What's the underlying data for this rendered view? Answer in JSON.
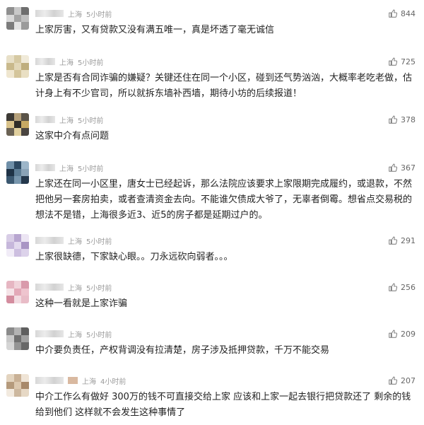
{
  "comments": [
    {
      "location": "上海",
      "time": "5小时前",
      "likes": "844",
      "text": "上家厉害，又有贷款又没有满五唯一，真是坏透了毫无诚信"
    },
    {
      "location": "上海",
      "time": "5小时前",
      "likes": "725",
      "text": "上家是否有合同诈骗的嫌疑？关键还住在同一个小区，碰到还气势汹汹，大概率老吃老做，估计身上有不少官司，所以就拆东墙补西墙，期待小坊的后续报道！"
    },
    {
      "location": "上海",
      "time": "5小时前",
      "likes": "378",
      "text": "这家中介有点问题"
    },
    {
      "location": "上海",
      "time": "5小时前",
      "likes": "367",
      "text": "上家还在同一小区里，唐女士已经起诉，那么法院应该要求上家限期完成履约，或退款，不然把他另一套房拍卖，或者查清资金去向。不能谁欠债成大爷了，无辜者倒霉。想省点交易税的想法不是错，上海很多近3、近5的房子都是延期过户的。"
    },
    {
      "location": "上海",
      "time": "5小时前",
      "likes": "291",
      "text": "上家很缺德，下家缺心眼。。刀永远砍向弱者。。。"
    },
    {
      "location": "上海",
      "time": "5小时前",
      "likes": "256",
      "text": "这种一看就是上家诈骗"
    },
    {
      "location": "上海",
      "time": "5小时前",
      "likes": "209",
      "text": "中介要负责任，产权背调没有拉清楚，房子涉及抵押贷款，千万不能交易"
    },
    {
      "location": "上海",
      "time": "4小时前",
      "likes": "207",
      "text": "中介工作么有做好 300万的钱不可直接交给上家 应该和上家一起去银行把贷款还了 剩余的钱给到他们 这样就不会发生这种事情了"
    }
  ],
  "colors": {
    "text": "#222222",
    "meta": "#9a9a9a",
    "likes": "#666666"
  },
  "icons": {
    "like": "thumbs-up-icon"
  }
}
